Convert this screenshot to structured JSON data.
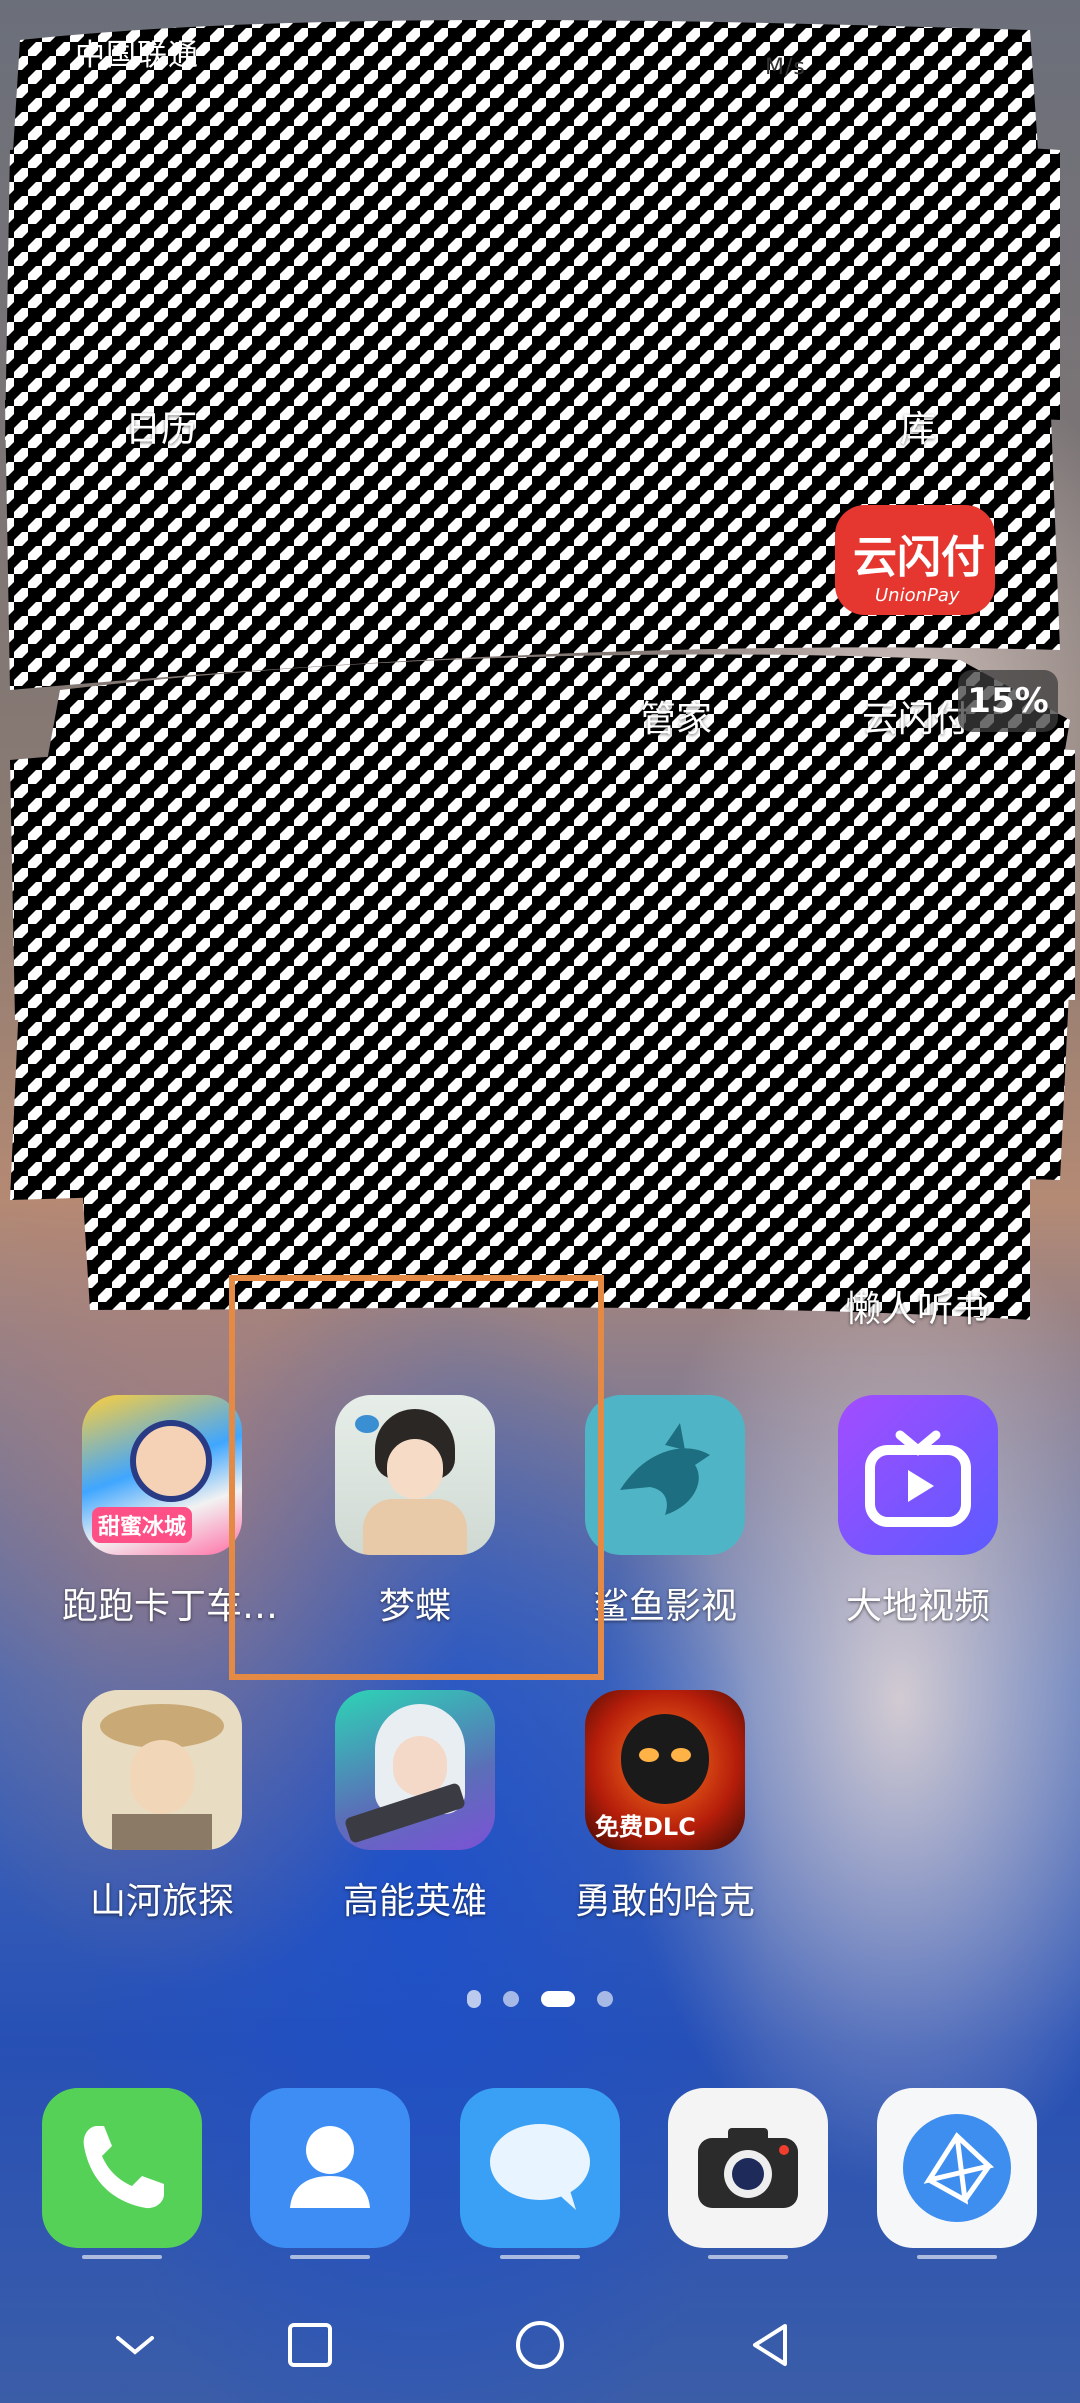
{
  "status_bar": {
    "carrier": "中国联通",
    "speed": "M/s"
  },
  "battery": {
    "level": "15%"
  },
  "partial_labels": [
    "日历",
    "管家",
    "云闪付",
    "库",
    "懒人听书"
  ],
  "partial_brand": {
    "text": "云闪付",
    "sub": "UnionPay"
  },
  "apps_row1": [
    {
      "label": "跑跑卡丁车…",
      "icon": "kart-game-icon"
    },
    {
      "label": "梦蝶",
      "icon": "dream-butterfly-icon"
    },
    {
      "label": "鲨鱼影视",
      "icon": "shark-video-icon"
    },
    {
      "label": "大地视频",
      "icon": "dadi-video-icon"
    }
  ],
  "apps_row2": [
    {
      "label": "山河旅探",
      "icon": "detective-game-icon"
    },
    {
      "label": "高能英雄",
      "icon": "hero-game-icon"
    },
    {
      "label": "勇敢的哈克",
      "icon": "brave-hack-icon",
      "badge": "免费DLC"
    }
  ],
  "kart_badge": "甜蜜冰城",
  "dock": [
    {
      "name": "phone",
      "icon": "phone-icon"
    },
    {
      "name": "contacts",
      "icon": "contacts-icon"
    },
    {
      "name": "messages",
      "icon": "messages-icon"
    },
    {
      "name": "camera",
      "icon": "camera-icon"
    },
    {
      "name": "browser",
      "icon": "browser-icon"
    }
  ],
  "page_indicator": {
    "pages": 4,
    "current": 3
  },
  "colors": {
    "highlight": "#e58a45",
    "phone": "#4cd964",
    "contacts": "#3d8df5",
    "messages": "#3aa0f5",
    "dadi": "#7a4dff"
  }
}
